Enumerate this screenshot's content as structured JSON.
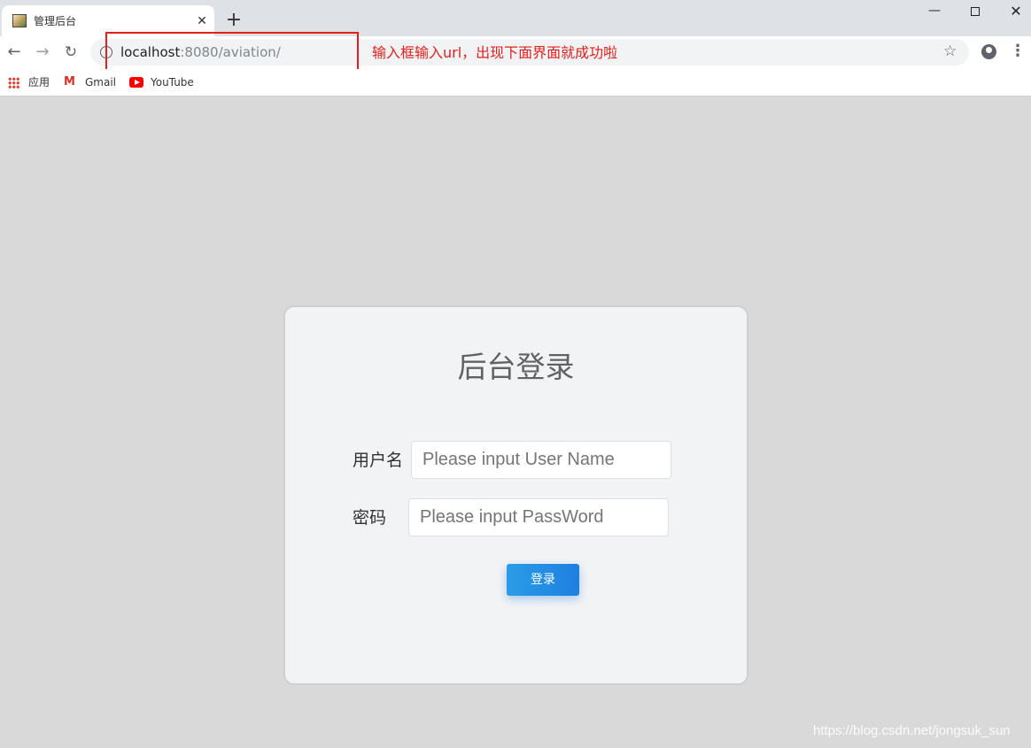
{
  "browser": {
    "tab": {
      "title": "管理后台",
      "close_glyph": "✕"
    },
    "new_tab_glyph": "+",
    "window_controls": {
      "minimize_glyph": "—",
      "close_glyph": "✕"
    },
    "toolbar": {
      "back_glyph": "←",
      "forward_glyph": "→",
      "reload_glyph": "↻",
      "star_glyph": "☆",
      "menu_glyph": "⋮"
    },
    "address_bar": {
      "host": "localhost",
      "rest": ":8080/aviation/"
    },
    "bookmarks": [
      {
        "label": "应用",
        "icon": "apps-grid-icon"
      },
      {
        "label": "Gmail",
        "icon": "gmail-icon",
        "glyph": "M"
      },
      {
        "label": "YouTube",
        "icon": "youtube-icon"
      }
    ]
  },
  "annotation": {
    "text": "输入框输入url，出现下面界面就成功啦",
    "color": "#e0201c"
  },
  "login": {
    "title": "后台登录",
    "username_label": "用户名",
    "username_placeholder": "Please input User Name",
    "password_label": "密码",
    "password_placeholder": "Please input PassWord",
    "submit_label": "登录",
    "button_color": "#1e7fe0"
  },
  "watermark": "https://blog.csdn.net/jongsuk_sun"
}
